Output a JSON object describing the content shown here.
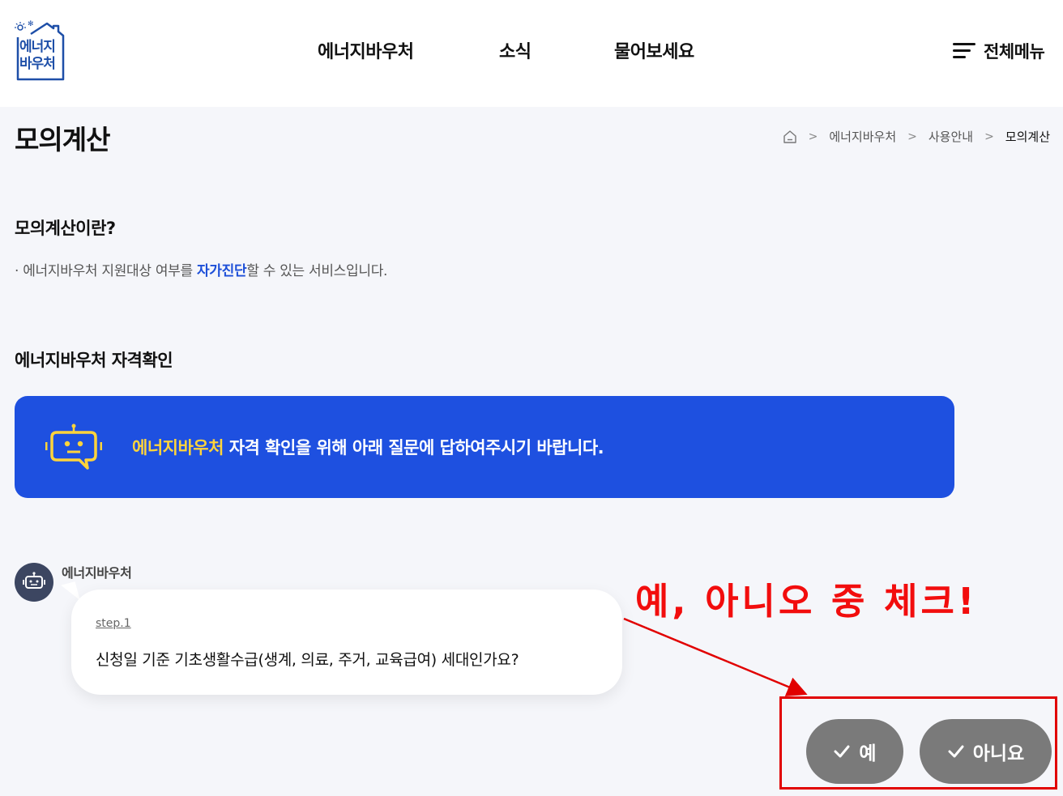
{
  "header": {
    "logo_text": "에너지\n바우처",
    "logo_line1": "에너지",
    "logo_line2": "바우처",
    "nav": [
      "에너지바우처",
      "소식",
      "물어보세요"
    ],
    "all_menu_label": "전체메뉴"
  },
  "page": {
    "title": "모의계산",
    "breadcrumb": [
      "에너지바우처",
      "사용안내",
      "모의계산"
    ]
  },
  "intro": {
    "heading": "모의계산이란?",
    "desc_prefix": "· 에너지바우처 지원대상 여부를 ",
    "desc_highlight": "자가진단",
    "desc_suffix": "할 수 있는 서비스입니다."
  },
  "qualify": {
    "heading": "에너지바우처 자격확인",
    "banner_highlight": "에너지바우처",
    "banner_text": " 자격 확인을 위해 아래 질문에 답하여주시기 바랍니다."
  },
  "chat": {
    "bot_name": "에너지바우처",
    "step_label": "step.1",
    "question": "신청일 기준 기초생활수급(생계, 의료, 주거, 교육급여) 세대인가요?"
  },
  "annotation": {
    "text": "예, 아니오 중 체크!",
    "color": "#f20d0d"
  },
  "answers": {
    "yes_label": "예",
    "no_label": "아니요"
  },
  "colors": {
    "brand_blue": "#1e50e0",
    "highlight_yellow": "#ffd43b",
    "button_gray": "#7a7a7a",
    "avatar_bg": "#3c4661"
  }
}
